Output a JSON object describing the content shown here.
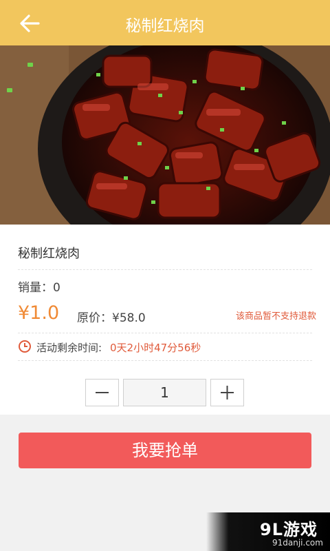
{
  "header": {
    "title": "秘制红烧肉",
    "back_icon": "back-arrow-icon"
  },
  "hero_image": {
    "description_icon": "dish-photo"
  },
  "product": {
    "name": "秘制红烧肉",
    "sales": "销量：0",
    "price": "¥1.0",
    "original_price": "原价：¥58.0",
    "refund_note": "该商品暂不支持退款",
    "timer_label": "活动剩余时间:",
    "timer_value": "0天2小时47分56秒"
  },
  "quantity": {
    "value": "1",
    "minus_icon": "minus-icon",
    "plus_icon": "plus-icon"
  },
  "actions": {
    "grab_label": "我要抢单"
  },
  "watermark": {
    "brand": "9L游戏",
    "site": "91danji.com"
  },
  "colors": {
    "header": "#f2c65d",
    "price": "#f08a35",
    "accent_red": "#e05a3a",
    "button": "#f25a5a"
  }
}
